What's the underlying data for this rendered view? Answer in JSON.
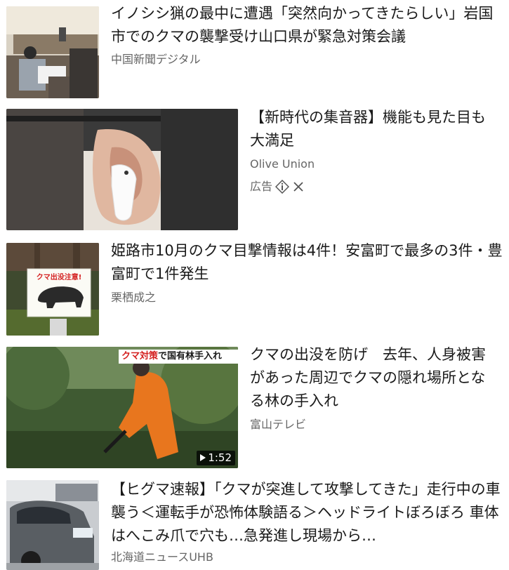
{
  "articles": [
    {
      "title": "イノシシ猟の最中に遭遇「突然向かってきたらしい」岩国市でのクマの襲撃受け山口県が緊急対策会議",
      "source": "中国新聞デジタル"
    },
    {
      "title": "【新時代の集音器】機能も見た目も大満足",
      "source": "Olive Union",
      "ad_label": "広告"
    },
    {
      "title": "姫路市10月のクマ目撃情報は4件！安富町で最多の3件・豊富町で1件発生",
      "source": "栗栖成之",
      "sign_text": "クマ出没注意!"
    },
    {
      "title": "クマの出没を防げ　去年、人身被害があった周辺でクマの隠れ場所となる林の手入れ",
      "source": "富山テレビ",
      "video_duration": "1:52",
      "caption_highlight": "クマ対策",
      "caption_rest": "で国有林手入れ"
    },
    {
      "title": "【ヒグマ速報】「クマが突進して攻撃してきた」走行中の車襲う＜運転手が恐怖体験語る＞ヘッドライトぼろぼろ 車体はへこみ爪で穴も…急発進し現場から…",
      "source": "北海道ニュースUHB"
    }
  ]
}
